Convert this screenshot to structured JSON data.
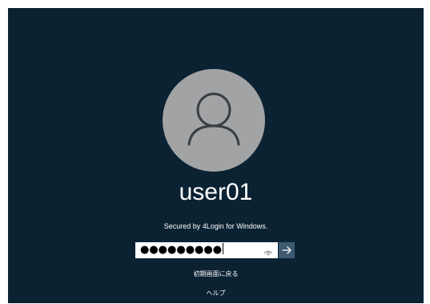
{
  "login": {
    "username": "user01",
    "secured_text": "Secured by 4Login for  Windows.",
    "password_masked": "●●●●●●●●●",
    "reset_link": "初期画面に戻る",
    "help_link": "ヘルプ"
  },
  "icons": {
    "avatar": "user-avatar-icon",
    "reveal": "eye-icon",
    "submit": "arrow-right-icon"
  },
  "colors": {
    "background": "#0b2233",
    "avatar": "#a1a3a5",
    "submit_button": "#3d5a70",
    "text": "#ffffff"
  }
}
